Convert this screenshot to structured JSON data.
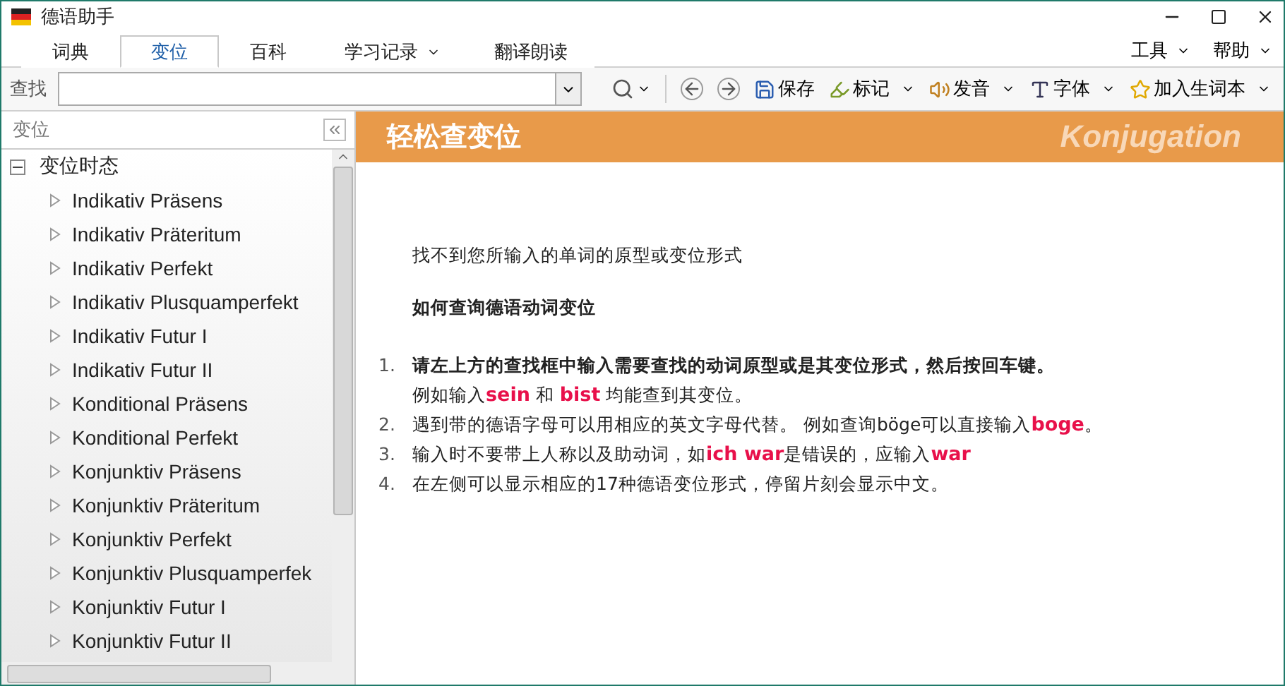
{
  "window": {
    "title": "德语助手"
  },
  "tabs": [
    {
      "label": "词典",
      "selected": false,
      "dropdown": false
    },
    {
      "label": "变位",
      "selected": true,
      "dropdown": false
    },
    {
      "label": "百科",
      "selected": false,
      "dropdown": false
    },
    {
      "label": "学习记录",
      "selected": false,
      "dropdown": true
    },
    {
      "label": "翻译朗读",
      "selected": false,
      "dropdown": false
    }
  ],
  "menus": [
    {
      "label": "工具"
    },
    {
      "label": "帮助"
    }
  ],
  "toolbar": {
    "search_label": "查找",
    "buttons": [
      {
        "kind": "save",
        "label": "保存",
        "dropdown": false
      },
      {
        "kind": "mark",
        "label": "标记",
        "dropdown": true
      },
      {
        "kind": "sound",
        "label": "发音",
        "dropdown": true
      },
      {
        "kind": "font",
        "label": "字体",
        "dropdown": true
      },
      {
        "kind": "star",
        "label": "加入生词本",
        "dropdown": true
      }
    ]
  },
  "sidebar": {
    "title": "变位",
    "tree": {
      "label": "变位时态",
      "expanded": true,
      "children": [
        {
          "label": "Indikativ Präsens"
        },
        {
          "label": "Indikativ Präteritum"
        },
        {
          "label": "Indikativ Perfekt"
        },
        {
          "label": "Indikativ Plusquamperfekt"
        },
        {
          "label": "Indikativ Futur I"
        },
        {
          "label": "Indikativ Futur II"
        },
        {
          "label": "Konditional Präsens"
        },
        {
          "label": "Konditional Perfekt"
        },
        {
          "label": "Konjunktiv Präsens"
        },
        {
          "label": "Konjunktiv Präteritum"
        },
        {
          "label": "Konjunktiv Perfekt"
        },
        {
          "label": "Konjunktiv Plusquamperfek"
        },
        {
          "label": "Konjunktiv Futur I"
        },
        {
          "label": "Konjunktiv Futur II"
        }
      ]
    }
  },
  "content": {
    "banner": {
      "title": "轻松查变位",
      "subtitle": "Konjugation"
    },
    "message": "找不到您所输入的单词的原型或变位形式",
    "heading": "如何查询德语动词变位",
    "steps": [
      {
        "number": "1.",
        "lines": [
          [
            {
              "kind": "strong",
              "text": "请左上方的查找框中输入需要查找的动词原型或是其变位形式，然后按回车键。"
            }
          ],
          [
            {
              "kind": "plain",
              "text": "例如输入"
            },
            {
              "kind": "keyword",
              "text": "sein"
            },
            {
              "kind": "plain",
              "text": " 和 "
            },
            {
              "kind": "keyword",
              "text": "bist"
            },
            {
              "kind": "plain",
              "text": " 均能查到其变位。"
            }
          ]
        ]
      },
      {
        "number": "2.",
        "lines": [
          [
            {
              "kind": "plain",
              "text": "遇到带的德语字母可以用相应的英文字母代替。 例如查询böge可以直接输入"
            },
            {
              "kind": "keyword",
              "text": "boge"
            },
            {
              "kind": "plain",
              "text": "。"
            }
          ]
        ]
      },
      {
        "number": "3.",
        "lines": [
          [
            {
              "kind": "plain",
              "text": "输入时不要带上人称以及助动词，如"
            },
            {
              "kind": "keyword",
              "text": "ich war"
            },
            {
              "kind": "plain",
              "text": "是错误的，应输入"
            },
            {
              "kind": "keyword",
              "text": "war"
            }
          ]
        ]
      },
      {
        "number": "4.",
        "lines": [
          [
            {
              "kind": "plain",
              "text": "在左侧可以显示相应的17种德语变位形式，停留片刻会显示中文。"
            }
          ]
        ]
      }
    ]
  }
}
